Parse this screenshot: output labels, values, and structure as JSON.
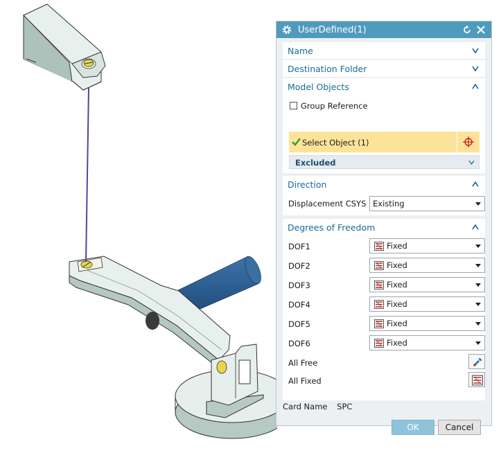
{
  "dialog": {
    "title": "UserDefined(1)",
    "sections": {
      "name": {
        "label": "Name"
      },
      "destination": {
        "label": "Destination Folder"
      },
      "model_objects": {
        "label": "Model Objects",
        "group_reference": {
          "label": "Group Reference",
          "checked": false
        },
        "select_object": "Select Object (1)",
        "excluded": "Excluded"
      },
      "direction": {
        "label": "Direction",
        "csys_label": "Displacement CSYS",
        "csys_value": "Existing"
      },
      "dof": {
        "label": "Degrees of Freedom",
        "rows": [
          {
            "label": "DOF1",
            "value": "Fixed"
          },
          {
            "label": "DOF2",
            "value": "Fixed"
          },
          {
            "label": "DOF3",
            "value": "Fixed"
          },
          {
            "label": "DOF4",
            "value": "Fixed"
          },
          {
            "label": "DOF5",
            "value": "Fixed"
          },
          {
            "label": "DOF6",
            "value": "Fixed"
          }
        ],
        "all_free": "All Free",
        "all_fixed": "All Fixed"
      }
    },
    "card_name_label": "Card Name",
    "card_name_value": "SPC",
    "ok": "OK",
    "cancel": "Cancel"
  },
  "colors": {
    "title_bar": "#4f9bbd",
    "section_text": "#1a6a96",
    "selection_highlight": "#fde39a",
    "model_fill": "#c9dbd6",
    "shaft": "#2d5f92",
    "constraint_line": "#5b3f9e"
  },
  "icons": [
    "gear-icon",
    "reset-icon",
    "close-icon",
    "chevron-down-icon",
    "chevron-up-icon",
    "checkmark-icon",
    "crosshair-icon",
    "fixed-constraint-icon",
    "free-constraint-icon"
  ]
}
